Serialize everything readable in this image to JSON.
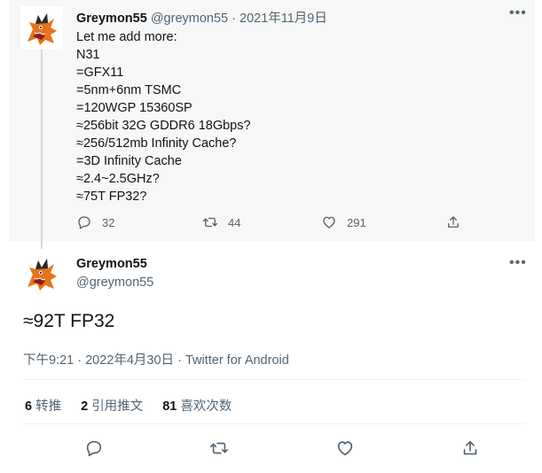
{
  "first_tweet": {
    "display_name": "Greymon55",
    "handle": "@greymon55",
    "separator": "·",
    "date": "2021年11月9日",
    "more": "•••",
    "lines": [
      "Let me add more:",
      "N31",
      "=GFX11",
      "=5nm+6nm TSMC",
      "=120WGP 15360SP",
      "≈256bit 32G GDDR6 18Gbps?",
      "≈256/512mb Infinity Cache?",
      "=3D Infinity Cache",
      "≈2.4~2.5GHz?",
      "≈75T FP32?"
    ],
    "actions": {
      "reply_count": "32",
      "retweet_count": "44",
      "like_count": "291"
    }
  },
  "second_tweet": {
    "display_name": "Greymon55",
    "handle": "@greymon55",
    "more": "•••",
    "text": "≈92T FP32",
    "meta": "下午9:21 · 2022年4月30日 · Twitter for Android",
    "stats": [
      {
        "count": "6",
        "label": "转推"
      },
      {
        "count": "2",
        "label": "引用推文"
      },
      {
        "count": "81",
        "label": "喜欢次数"
      }
    ]
  },
  "colors": {
    "text": "#0f1419",
    "muted": "#536471",
    "thread_line": "#cfd9de",
    "highlight_bg": "#f7f7f7"
  },
  "icons": [
    "avatar-greymon",
    "more-icon",
    "reply-icon",
    "retweet-icon",
    "like-icon",
    "share-icon"
  ]
}
